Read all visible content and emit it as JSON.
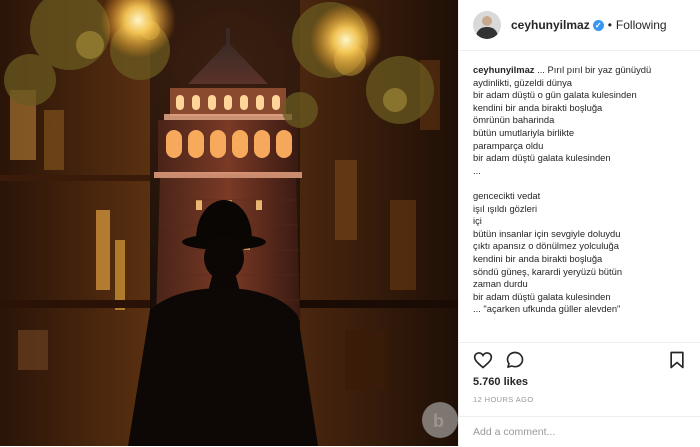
{
  "post": {
    "username": "ceyhunyilmaz",
    "follow_status": "Following",
    "caption_user": "ceyhunyilmaz",
    "caption_lines": [
      " ... Pırıl pırıl bir yaz günüydü",
      "aydinlikti, güzeldi dünya",
      "bir adam düştü o gün galata kulesinden",
      "kendini bir anda birakti boşluğa",
      "ömrünün baharinda",
      "bütün umutlariyla birlikte",
      "paramparça oldu",
      "bir adam düştü galata kulesinden",
      "...",
      "",
      "gencecikti vedat",
      "işıl ışıldı gözleri",
      "içi",
      "bütün insanlar için sevgiyle doluydu",
      "çıktı apansız o dönülmez yolculuğa",
      "kendini bir anda birakti boşluğa",
      "söndü güneş, karardi yeryüzü bütün",
      "zaman durdu",
      "bir adam düştü galata kulesinden",
      "... \"açarken ufkunda güller alevden\""
    ],
    "likes": "5.760 likes",
    "time_ago": "12 HOURS AGO",
    "comment_placeholder": "Add a comment..."
  },
  "colors": {
    "verified": "#3897f0",
    "username": "#262626",
    "muted": "#999999"
  },
  "icons": [
    "heart-icon",
    "comment-icon",
    "bookmark-icon",
    "verified-badge-icon"
  ]
}
